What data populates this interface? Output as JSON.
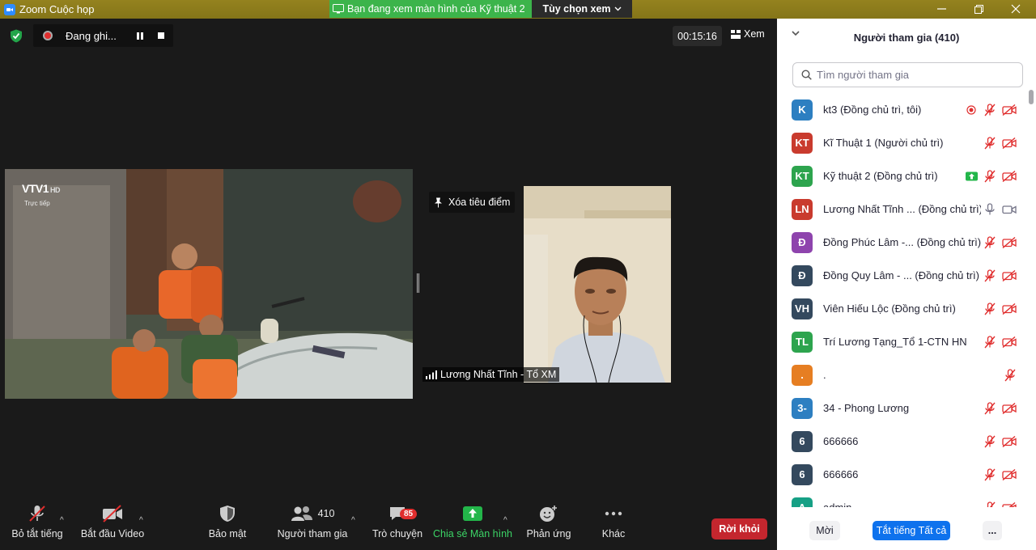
{
  "titlebar": {
    "title": "Zoom Cuộc họp",
    "share_notice": "Bạn đang xem màn hình của Kỹ thuật 2",
    "view_options": "Tùy chọn xem"
  },
  "meeting": {
    "recording_label": "Đang ghi...",
    "timer": "00:15:16",
    "view_label": "Xem",
    "unspotlight_label": "Xóa tiêu điểm",
    "speaker_name": "Lương Nhất Tĩnh - Tổ XM",
    "broadcast_logo": "VTV1",
    "broadcast_hd": "HD",
    "broadcast_live": "Trực tiếp"
  },
  "toolbar": {
    "mute_all": "Bỏ tắt tiếng",
    "start_video": "Bắt đầu Video",
    "security": "Bảo mật",
    "participants": "Người tham gia",
    "participants_count": "410",
    "chat": "Trò chuyện",
    "chat_badge": "85",
    "share_screen": "Chia sẻ Màn hình",
    "reactions": "Phản ứng",
    "more": "Khác",
    "leave": "Rời khỏi"
  },
  "panel": {
    "title": "Người tham gia (410)",
    "search_placeholder": "Tìm người tham gia",
    "participants": [
      {
        "initials": "K",
        "color": "#2d7fc1",
        "name": "kt3 (Đồng chủ trì, tôi)",
        "extra": "recording",
        "mic": "muted",
        "cam": "off"
      },
      {
        "initials": "KT",
        "color": "#c93b2e",
        "name": "Kĩ Thuật 1 (Người chủ trì)",
        "extra": "",
        "mic": "muted",
        "cam": "off"
      },
      {
        "initials": "KT",
        "color": "#2da44e",
        "name": "Kỹ thuật 2 (Đồng chủ trì)",
        "extra": "sharing",
        "mic": "muted",
        "cam": "off"
      },
      {
        "initials": "LN",
        "color": "#c93b2e",
        "name": "Lương Nhất Tĩnh ... (Đồng chủ trì)",
        "extra": "",
        "mic": "on",
        "cam": "on"
      },
      {
        "initials": "Đ",
        "color": "#8e44ad",
        "name": "Đồng Phúc Lâm -... (Đồng chủ trì)",
        "extra": "",
        "mic": "muted",
        "cam": "off"
      },
      {
        "initials": "Đ",
        "color": "#34495e",
        "name": "Đồng Quy Lâm - ... (Đồng chủ trì)",
        "extra": "",
        "mic": "muted",
        "cam": "off"
      },
      {
        "initials": "VH",
        "color": "#34495e",
        "name": "Viên Hiếu Lộc (Đồng chủ trì)",
        "extra": "",
        "mic": "muted",
        "cam": "off"
      },
      {
        "initials": "TL",
        "color": "#2da44e",
        "name": " Trí Lương Tạng_Tổ 1-CTN HN",
        "extra": "",
        "mic": "muted",
        "cam": "off"
      },
      {
        "initials": ".",
        "color": "#e67e22",
        "name": ".",
        "extra": "",
        "mic": "muted",
        "cam": "none"
      },
      {
        "initials": "3-",
        "color": "#2d7fc1",
        "name": "34 - Phong Lương",
        "extra": "",
        "mic": "muted",
        "cam": "off"
      },
      {
        "initials": "6",
        "color": "#34495e",
        "name": "666666",
        "extra": "",
        "mic": "muted",
        "cam": "off"
      },
      {
        "initials": "6",
        "color": "#34495e",
        "name": "666666",
        "extra": "",
        "mic": "muted",
        "cam": "off"
      },
      {
        "initials": "A",
        "color": "#16a085",
        "name": "admin",
        "extra": "",
        "mic": "muted",
        "cam": "off"
      }
    ],
    "invite_label": "Mời",
    "mute_all_label": "Tắt tiếng Tất cả",
    "more_label": "..."
  },
  "colors": {
    "titlebar": "#8c7b1c",
    "share_green": "#3cb44b",
    "leave_red": "#c4262e",
    "primary_blue": "#0e72ed"
  }
}
